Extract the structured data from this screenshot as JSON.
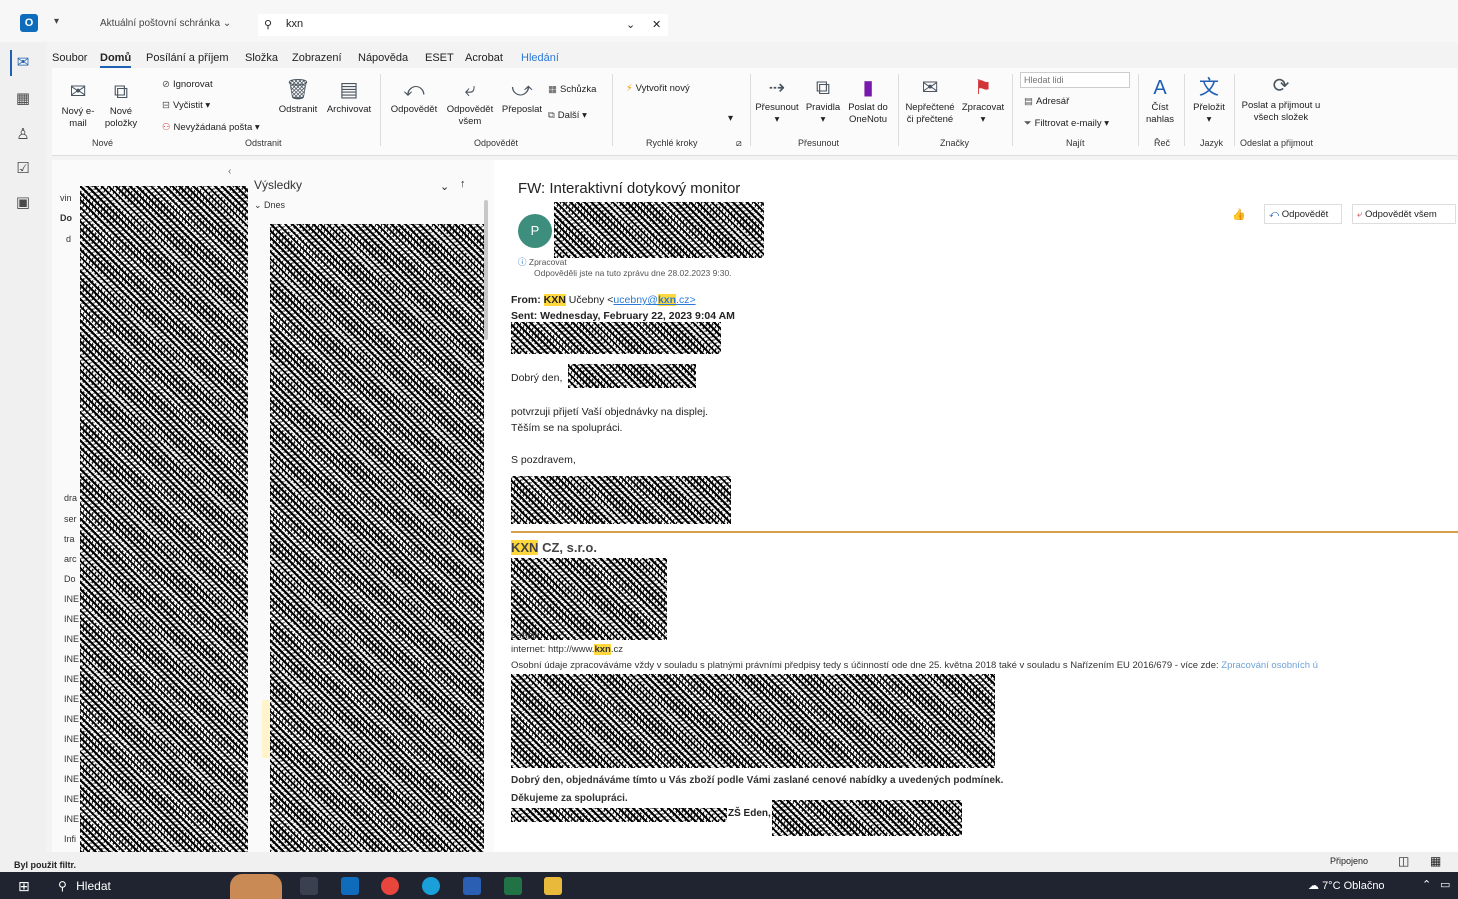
{
  "titlebar": {
    "scope": "Aktuální poštovní schránka",
    "search_value": "kxn"
  },
  "menu": [
    "Soubor",
    "Domů",
    "Posílání a příjem",
    "Složka",
    "Zobrazení",
    "Nápověda",
    "ESET",
    "Acrobat",
    "Hledání"
  ],
  "ribbon": {
    "new_email": "Nový e-mail",
    "new_items": "Nové položky",
    "group_new": "Nové",
    "ignore": "Ignorovat",
    "cleanup": "Vyčistit",
    "junk": "Nevyžádaná pošta",
    "delete": "Odstranit",
    "archive": "Archivovat",
    "group_delete": "Odstranit",
    "reply": "Odpovědět",
    "reply_all": "Odpovědět všem",
    "forward": "Přeposlat",
    "meeting": "Schůzka",
    "more": "Další",
    "group_respond": "Odpovědět",
    "create_new": "Vytvořit nový",
    "group_quick": "Rychlé kroky",
    "move": "Přesunout",
    "rules": "Pravidla",
    "onenote": "Poslat do OneNotu",
    "group_move": "Přesunout",
    "unread_read": "Nepřečtené či přečtené",
    "process": "Zpracovat",
    "group_tags": "Značky",
    "find_people_placeholder": "Hledat lidi",
    "address_book": "Adresář",
    "filter_email": "Filtrovat e-maily",
    "group_find": "Najít",
    "read_aloud": "Číst nahlas",
    "group_speech": "Řeč",
    "translate": "Přeložit",
    "group_language": "Jazyk",
    "send_receive_all": "Poslat a přijmout u všech složek",
    "group_send_receive": "Odeslat a přijmout"
  },
  "folders": {
    "items": [
      "vin",
      "Do",
      "d",
      "dra",
      "ser",
      "tra",
      "arc",
      "Do",
      "INE",
      "INE",
      "INE",
      "INE",
      "INE",
      "INE",
      "INE",
      "INE",
      "INE",
      "INE",
      "INE",
      "INE",
      "Infi"
    ]
  },
  "message_list": {
    "header": "Výsledky",
    "group_today": "Dnes"
  },
  "email": {
    "subject": "FW: Interaktivní dotykový monitor",
    "avatar_initial": "P",
    "info_line1": "Zpracovat",
    "info_line2": "Odpověděli jste na tuto zprávu dne 28.02.2023 9:30.",
    "reply_label": "Odpovědět",
    "reply_all_label": "Odpovědět všem",
    "from_label": "From:",
    "from_brand": "KXN",
    "from_name": "Učebny <",
    "from_email_user": "ucebny@",
    "from_email_domain": "kxn",
    "from_email_tld": ".cz>",
    "sent_line": "Sent: Wednesday, February 22, 2023 9:04 AM",
    "greeting": "Dobrý den,",
    "body1": "potvrzuji přijetí Vaší objednávky na displej.",
    "body2": "Těším se na spolupráci.",
    "regards": "S pozdravem,",
    "company_brand": "KXN",
    "company_rest": " CZ, s.r.o.",
    "email_label": "e-mail:",
    "internet_label": "internet: http://www.",
    "internet_brand": "kxn",
    "internet_tld": ".cz",
    "gdpr": "Osobní údaje zpracováváme vždy v souladu s platnými právními předpisy tedy s účinností ode dne 25. května 2018 také v souladu s Nařízením EU 2016/679 - více zde:",
    "gdpr_link": "Zpracování osobních ú",
    "order_line": "Dobrý den, objednáváme tímto u Vás zboží podle Vámi zaslané cenové nabídky a uvedených podmínek.",
    "thanks": "Děkujeme za spolupráci.",
    "school_fragment": "ZŠ Eden,"
  },
  "statusbar": {
    "left": "Byl použit filtr.",
    "right": "Připojeno"
  },
  "taskbar": {
    "search": "Hledat",
    "weather": "7°C Oblačno"
  }
}
